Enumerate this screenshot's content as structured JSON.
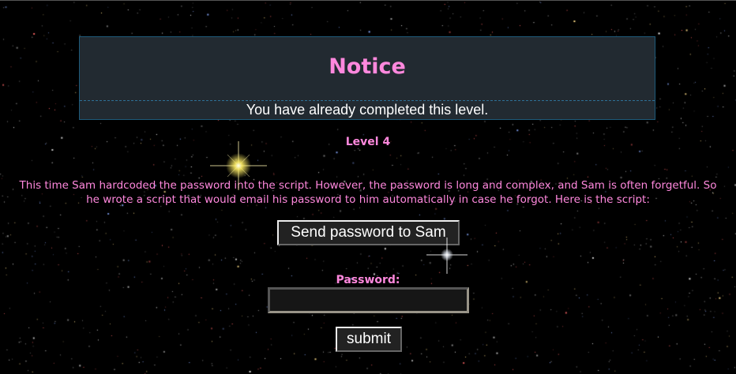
{
  "notice": {
    "title": "Notice",
    "message": "You have already completed this level."
  },
  "level": {
    "title": "Level 4",
    "description": "This time Sam hardcoded the password into the script. However, the password is long and complex, and Sam is often forgetful. So he wrote a script that would email his password to him automatically in case he forgot. Here is the script:"
  },
  "form": {
    "send_button_label": "Send password to Sam",
    "password_label": "Password:",
    "password_value": "",
    "submit_label": "submit"
  },
  "colors": {
    "background": "#000000",
    "accent_pink": "#ff88dd",
    "notice_bg": "#222a31",
    "notice_border": "#1e5a7a"
  }
}
